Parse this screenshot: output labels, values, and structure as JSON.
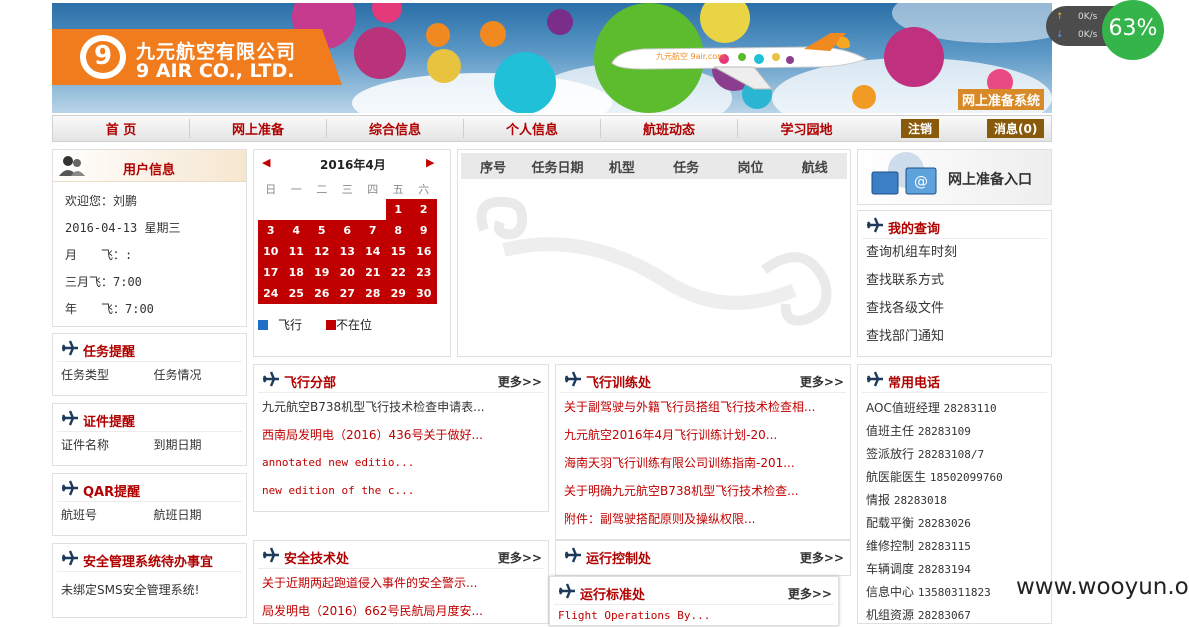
{
  "banner": {
    "logo_cn": "九元航空有限公司",
    "logo_en": "9 AIR CO., LTD.",
    "system_title": "网上准备系统"
  },
  "nav": {
    "items": [
      "首 页",
      "网上准备",
      "综合信息",
      "个人信息",
      "航班动态",
      "学习园地"
    ],
    "logout": "注销",
    "messages": "消息(0)"
  },
  "user_info": {
    "title": "用户信息",
    "welcome": "欢迎您：刘鹏",
    "date": "2016-04-13 星期三",
    "month_fly": "月　　飞：:",
    "quarter_fly": "三月飞：7:00",
    "year_fly": "年　　飞：7:00"
  },
  "calendar": {
    "title": "2016年4月",
    "weekdays": [
      "日",
      "一",
      "二",
      "三",
      "四",
      "五",
      "六"
    ],
    "legend_fly": "飞行",
    "legend_absent": "不在位",
    "colors": {
      "fly": "#1f6fc9",
      "absent": "#c00000"
    }
  },
  "task_table": {
    "headers": [
      "序号",
      "任务日期",
      "机型",
      "任务",
      "岗位",
      "航线"
    ]
  },
  "task_reminder": {
    "title": "任务提醒",
    "cols": [
      "任务类型",
      "任务情况"
    ]
  },
  "cert_reminder": {
    "title": "证件提醒",
    "cols": [
      "证件名称",
      "到期日期"
    ]
  },
  "qar_reminder": {
    "title": "QAR提醒",
    "cols": [
      "航班号",
      "航班日期"
    ]
  },
  "sms": {
    "title": "安全管理系统待办事宜",
    "text": "未绑定SMS安全管理系统!"
  },
  "flight_branch": {
    "title": "飞行分部",
    "more": "更多>>",
    "items": [
      "九元航空B738机型飞行技术检查申请表...",
      "西南局发明电（2016）436号关于做好...",
      "annotated new editio...",
      "new edition of the c..."
    ]
  },
  "flight_training": {
    "title": "飞行训练处",
    "more": "更多>>",
    "items": [
      "关于副驾驶与外籍飞行员搭组飞行技术检查相...",
      "九元航空2016年4月飞行训练计划-20...",
      "海南天羽飞行训练有限公司训练指南-201...",
      "关于明确九元航空B738机型飞行技术检查...",
      "附件：副驾驶搭配原则及操纵权限..."
    ]
  },
  "safety_tech": {
    "title": "安全技术处",
    "more": "更多>>",
    "items": [
      "关于近期两起跑道侵入事件的安全警示...",
      "局发明电（2016）662号民航局月度安..."
    ]
  },
  "ops_control": {
    "title": "运行控制处",
    "more": "更多>>"
  },
  "ops_standards": {
    "title": "运行标准处",
    "more": "更多>>",
    "items": [
      "Flight Operations By..."
    ]
  },
  "online_prep": {
    "title": "网上准备入口"
  },
  "my_query": {
    "title": "我的查询",
    "items": [
      "查询机组车时刻",
      "查找联系方式",
      "查找各级文件",
      "查找部门通知"
    ]
  },
  "phones": {
    "title": "常用电话",
    "items": [
      {
        "name": "AOC值班经理",
        "number": "28283110"
      },
      {
        "name": "值班主任",
        "number": "28283109"
      },
      {
        "name": "签派放行",
        "number": "28283108/7"
      },
      {
        "name": "航医能医生",
        "number": "18502099760"
      },
      {
        "name": "情报",
        "number": "28283018"
      },
      {
        "name": "配载平衡",
        "number": "28283026"
      },
      {
        "name": "维修控制",
        "number": "28283115"
      },
      {
        "name": "车辆调度",
        "number": "28283194"
      },
      {
        "name": "信息中心",
        "number": "13580311823"
      },
      {
        "name": "机组资源",
        "number": "28283067"
      }
    ]
  },
  "speed_widget": {
    "up": "0K/s",
    "down": "0K/s",
    "percent": "63%"
  },
  "watermark": "www.wooyun.org"
}
